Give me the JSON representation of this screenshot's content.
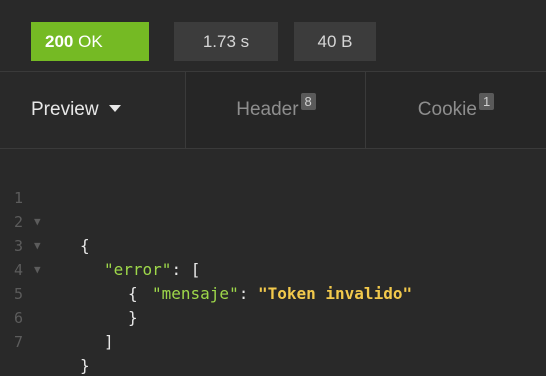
{
  "status_bar": {
    "status_code": "200",
    "status_text": "OK",
    "time": "1.73 s",
    "size": "40 B",
    "status_color": "#75ba24"
  },
  "tabs": [
    {
      "label": "Preview",
      "active": true
    },
    {
      "label": "Header",
      "count": "8"
    },
    {
      "label": "Cookie",
      "count": "1"
    }
  ],
  "code": {
    "line_numbers": [
      "1",
      "2",
      "3",
      "4",
      "5",
      "6",
      "7"
    ],
    "lines": [
      {
        "text": "{"
      },
      {
        "key": "\"error\"",
        "rest": ": ["
      },
      {
        "text": "{"
      },
      {
        "key": "\"mensaje\"",
        "sep": ": ",
        "value": "\"Token invalido\""
      },
      {
        "text": "}"
      },
      {
        "text": "]"
      },
      {
        "text": "}"
      }
    ],
    "colors": {
      "key": "#9ed84a",
      "string": "#f2c94c"
    }
  }
}
